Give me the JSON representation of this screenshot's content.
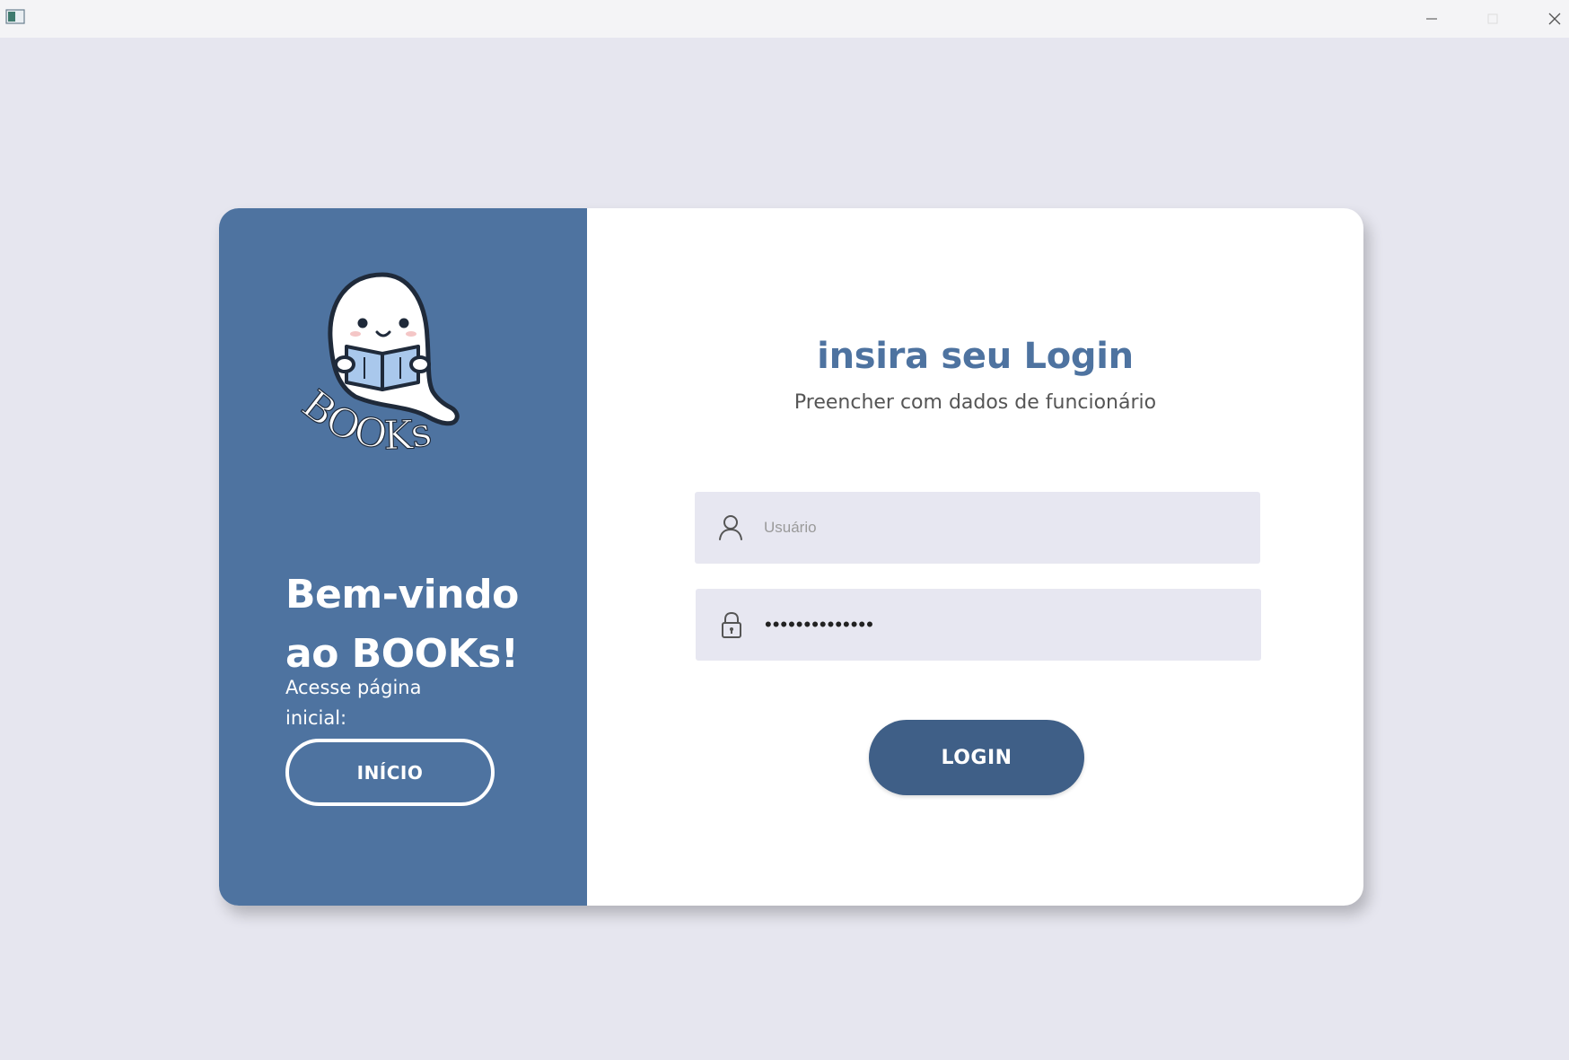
{
  "window": {
    "icons": {
      "app": "app-window-icon",
      "minimize": "minimize-icon",
      "maximize": "maximize-icon",
      "close": "close-icon"
    }
  },
  "left_panel": {
    "logo_text": "BOOKs",
    "welcome_line1": "Bem-vindo",
    "welcome_line2": "ao BOOKs!",
    "access_text": "Acesse página inicial:",
    "inicio_label": "INÍCIO"
  },
  "login": {
    "title": "insira seu Login",
    "subtitle": "Preencher com dados de funcionário",
    "username": {
      "placeholder": "Usuário",
      "value": "",
      "icon": "user-icon"
    },
    "password": {
      "value": "••••••••••••••",
      "icon": "lock-icon"
    },
    "button_label": "LOGIN"
  },
  "colors": {
    "background": "#e6e6ef",
    "panel_blue": "#4e73a0",
    "title_blue": "#4e73a0",
    "button_dark_blue": "#3f5f87",
    "field_bg": "#e7e7f1",
    "card_bg": "#ffffff"
  }
}
